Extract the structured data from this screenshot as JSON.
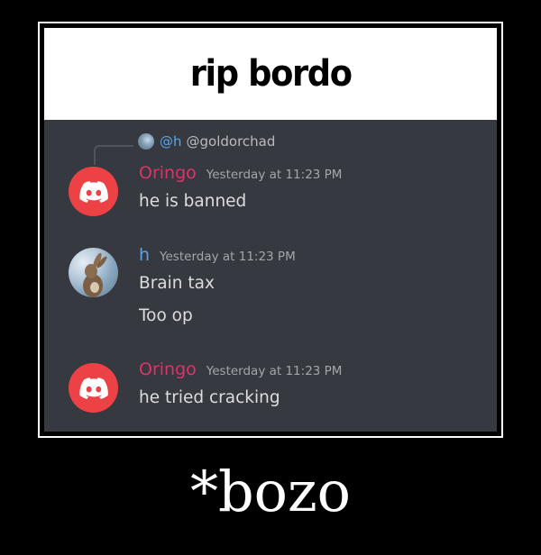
{
  "caption": "rip bordo",
  "reply": {
    "mention": "@h",
    "handle": "@goldorchad"
  },
  "messages": [
    {
      "username": "Oringo",
      "username_color": "#e0316b",
      "timestamp": "Yesterday at 11:23 PM",
      "lines": [
        "he is banned"
      ],
      "avatar": "discord-logo-icon"
    },
    {
      "username": "h",
      "username_color": "#5ba3e8",
      "timestamp": "Yesterday at 11:23 PM",
      "lines": [
        "Brain tax",
        "Too op"
      ],
      "avatar": "rabbit-photo"
    },
    {
      "username": "Oringo",
      "username_color": "#e0316b",
      "timestamp": "Yesterday at 11:23 PM",
      "lines": [
        "he tried cracking"
      ],
      "avatar": "discord-logo-icon"
    }
  ],
  "footer": "*bozo",
  "colors": {
    "chat_bg": "#36393f",
    "discord_red": "#ed4245",
    "text": "#dcddde"
  }
}
